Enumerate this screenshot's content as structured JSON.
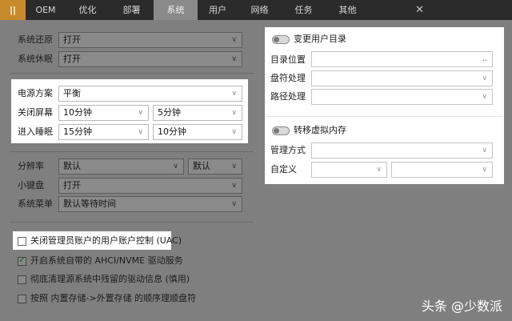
{
  "tabs": [
    {
      "label": "||"
    },
    {
      "label": "OEM"
    },
    {
      "label": "优化"
    },
    {
      "label": "部署"
    },
    {
      "label": "系统"
    },
    {
      "label": "用户"
    },
    {
      "label": "网络"
    },
    {
      "label": "任务"
    },
    {
      "label": "其他"
    }
  ],
  "system": {
    "restore_label": "系统还原",
    "restore_value": "打开",
    "hibernate_label": "系统休眠",
    "hibernate_value": "打开"
  },
  "power": {
    "plan_label": "电源方案",
    "plan_value": "平衡",
    "screen_label": "关闭屏幕",
    "screen_ac": "10分钟",
    "screen_dc": "5分钟",
    "sleep_label": "进入睡眠",
    "sleep_ac": "15分钟",
    "sleep_dc": "10分钟"
  },
  "display": {
    "resolution_label": "分辨率",
    "resolution_value": "默认",
    "resolution_extra": "默认",
    "keypad_label": "小键盘",
    "keypad_value": "打开",
    "menu_label": "系统菜单",
    "menu_value": "默认等待时间"
  },
  "checks": [
    {
      "label": "关闭管理员账户的用户账户控制 (UAC)",
      "checked": false
    },
    {
      "label": "开启系统自带的 AHCI/NVME 驱动服务",
      "checked": true
    },
    {
      "label": "彻底清理源系统中残留的驱动信息 (慎用)",
      "checked": false
    },
    {
      "label": "按照 内置存储->外置存储 的顺序理顺盘符",
      "checked": false
    }
  ],
  "userdir": {
    "toggle_label": "变更用户目录",
    "location_label": "目录位置",
    "location_button": "..",
    "drive_label": "盘符处理",
    "path_label": "路径处理"
  },
  "virtmem": {
    "toggle_label": "转移虚拟内存",
    "mode_label": "管理方式",
    "custom_label": "自定义"
  },
  "watermark": "头条 @少数派"
}
